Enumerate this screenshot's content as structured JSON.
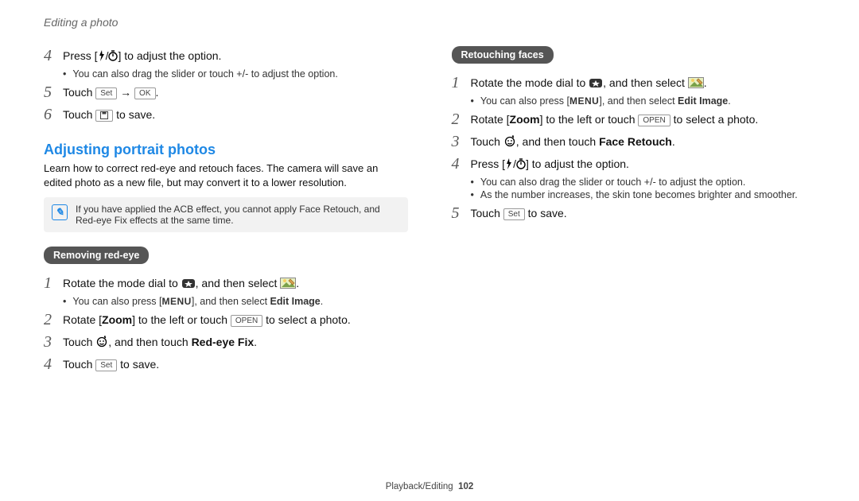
{
  "breadcrumb": "Editing a photo",
  "left": {
    "top_steps": {
      "s4": {
        "n": "4",
        "a": "Press [",
        "b": "] to adjust the option.",
        "bullet": "You can also drag the slider or touch +/- to adjust the option."
      },
      "s5": {
        "n": "5",
        "a": "Touch ",
        "arrow": " → ",
        "end": "."
      },
      "s6": {
        "n": "6",
        "a": "Touch ",
        "end": " to save."
      }
    },
    "heading": "Adjusting portrait photos",
    "intro": "Learn how to correct red-eye and retouch faces. The camera will save an edited photo as a new file, but may convert it to a lower resolution.",
    "note": "If you have applied the ACB effect, you cannot apply Face Retouch, and Red-eye Fix effects at the same time.",
    "tag": "Removing red-eye",
    "steps": {
      "s1": {
        "n": "1",
        "a": "Rotate the mode dial to ",
        "b": ", and then select ",
        "c": ".",
        "bullet_a": "You can also press [",
        "bullet_b": "], and then select ",
        "bullet_bold": "Edit Image",
        "bullet_c": "."
      },
      "s2": {
        "n": "2",
        "a": "Rotate [",
        "z": "Zoom",
        "b": "] to the left or touch ",
        "c": " to select a photo."
      },
      "s3": {
        "n": "3",
        "a": "Touch ",
        "b": ", and then touch ",
        "bold": "Red-eye Fix",
        "c": "."
      },
      "s4": {
        "n": "4",
        "a": "Touch ",
        "c": " to save."
      }
    }
  },
  "right": {
    "tag": "Retouching faces",
    "steps": {
      "s1": {
        "n": "1",
        "a": "Rotate the mode dial to ",
        "b": ", and then select ",
        "c": ".",
        "bullet_a": "You can also press [",
        "bullet_b": "], and then select ",
        "bullet_bold": "Edit Image",
        "bullet_c": "."
      },
      "s2": {
        "n": "2",
        "a": "Rotate [",
        "z": "Zoom",
        "b": "] to the left or touch ",
        "c": " to select a photo."
      },
      "s3": {
        "n": "3",
        "a": "Touch ",
        "b": ", and then touch ",
        "bold": "Face Retouch",
        "c": "."
      },
      "s4": {
        "n": "4",
        "a": "Press [",
        "b": "] to adjust the option.",
        "bullet1": "You can also drag the slider or touch +/- to adjust the option.",
        "bullet2": "As the number increases, the skin tone becomes brighter and smoother."
      },
      "s5": {
        "n": "5",
        "a": "Touch ",
        "c": " to save."
      }
    }
  },
  "keys": {
    "set": "Set",
    "ok": "OK",
    "open": "OPEN",
    "menu": "MENU"
  },
  "footer": {
    "section": "Playback/Editing",
    "page": "102"
  }
}
